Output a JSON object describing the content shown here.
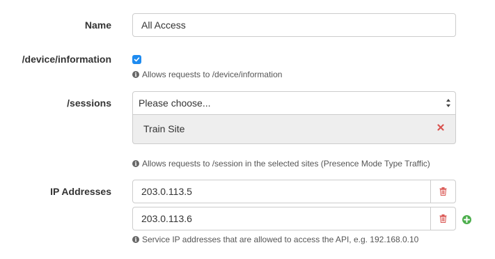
{
  "name_field": {
    "label": "Name",
    "value": "All Access"
  },
  "device_information": {
    "label": "/device/information",
    "checked": true,
    "help": "Allows requests to /device/information"
  },
  "sessions": {
    "label": "/sessions",
    "select_placeholder": "Please choose...",
    "selected_items": [
      "Train Site"
    ],
    "help": "Allows requests to /session in the selected sites (Presence Mode Type Traffic)"
  },
  "ip_addresses": {
    "label": "IP Addresses",
    "values": [
      "203.0.113.5",
      "203.0.113.6"
    ],
    "help": "Service IP addresses that are allowed to access the API, e.g. 192.168.0.10"
  },
  "colors": {
    "checkbox_accent": "#1e8bf0",
    "remove_red": "#d9534f",
    "add_green": "#4cae4c",
    "selected_bg": "#eeeeee"
  },
  "icons": {
    "info": "info-circle-icon",
    "remove": "times-icon",
    "trash": "trash-icon",
    "add": "plus-circle-icon",
    "select_arrows": "sort-icon"
  }
}
